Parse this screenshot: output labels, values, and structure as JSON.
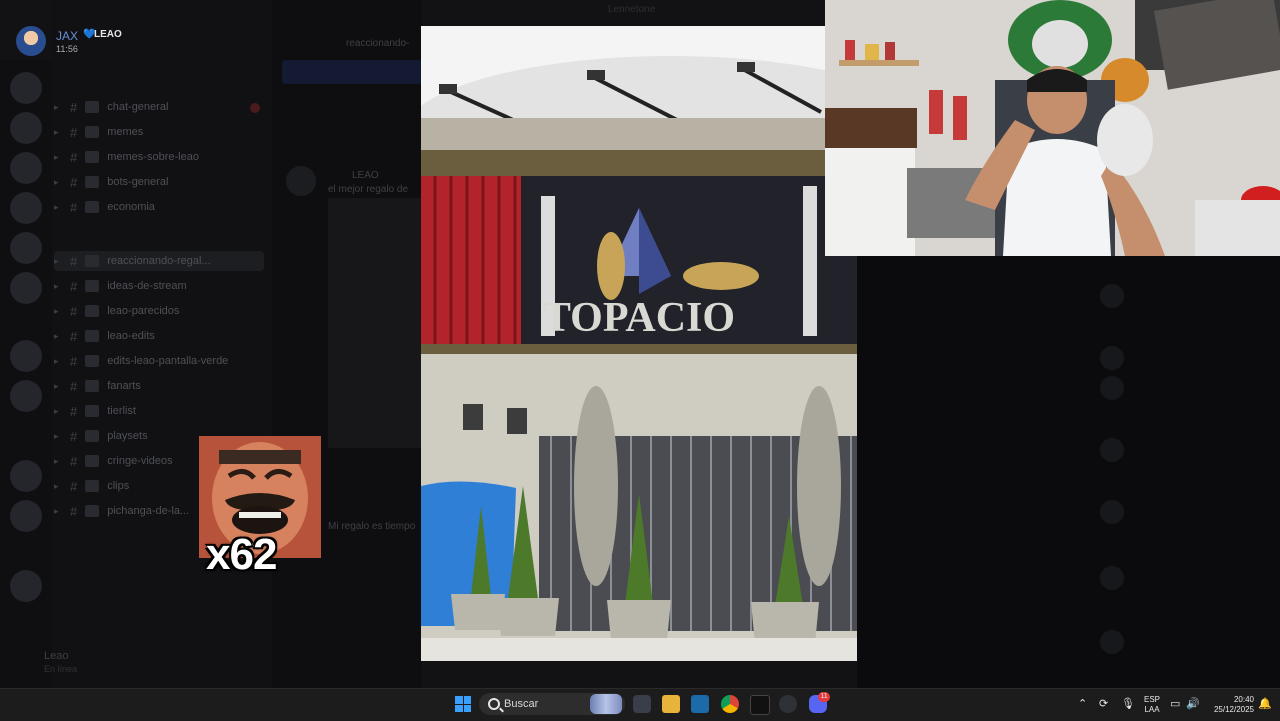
{
  "user": {
    "name": "JAX",
    "tag": "LEAO",
    "time": "11:56"
  },
  "topbar": {
    "title": "Lennetone"
  },
  "channels": [
    {
      "name": "chat-general"
    },
    {
      "name": "memes"
    },
    {
      "name": "memes-sobre-leao"
    },
    {
      "name": "bots-general"
    },
    {
      "name": "economia"
    },
    {
      "name": "reaccionando-regal..."
    },
    {
      "name": "ideas-de-stream"
    },
    {
      "name": "leao-parecidos"
    },
    {
      "name": "leao-edits"
    },
    {
      "name": "edits-leao-pantalla-verde"
    },
    {
      "name": "fanarts"
    },
    {
      "name": "tierlist"
    },
    {
      "name": "playsets"
    },
    {
      "name": "cringe-videos"
    },
    {
      "name": "clips"
    },
    {
      "name": "pichanga-de-la..."
    }
  ],
  "chat": {
    "header_channel": "reaccionando-",
    "author": "LEAO",
    "line1": "el mejor regalo de",
    "line2": "Mi regalo es tiempo"
  },
  "photo": {
    "sign_text": "TOPACIO"
  },
  "meme": {
    "count": "x62"
  },
  "bottom_user": {
    "name": "Leao",
    "status": "En línea"
  },
  "taskbar": {
    "search_placeholder": "Buscar",
    "lang_top": "ESP",
    "lang_bottom": "LAA",
    "time": "20:40",
    "date": "25/12/2025",
    "discord_badge": "11"
  }
}
